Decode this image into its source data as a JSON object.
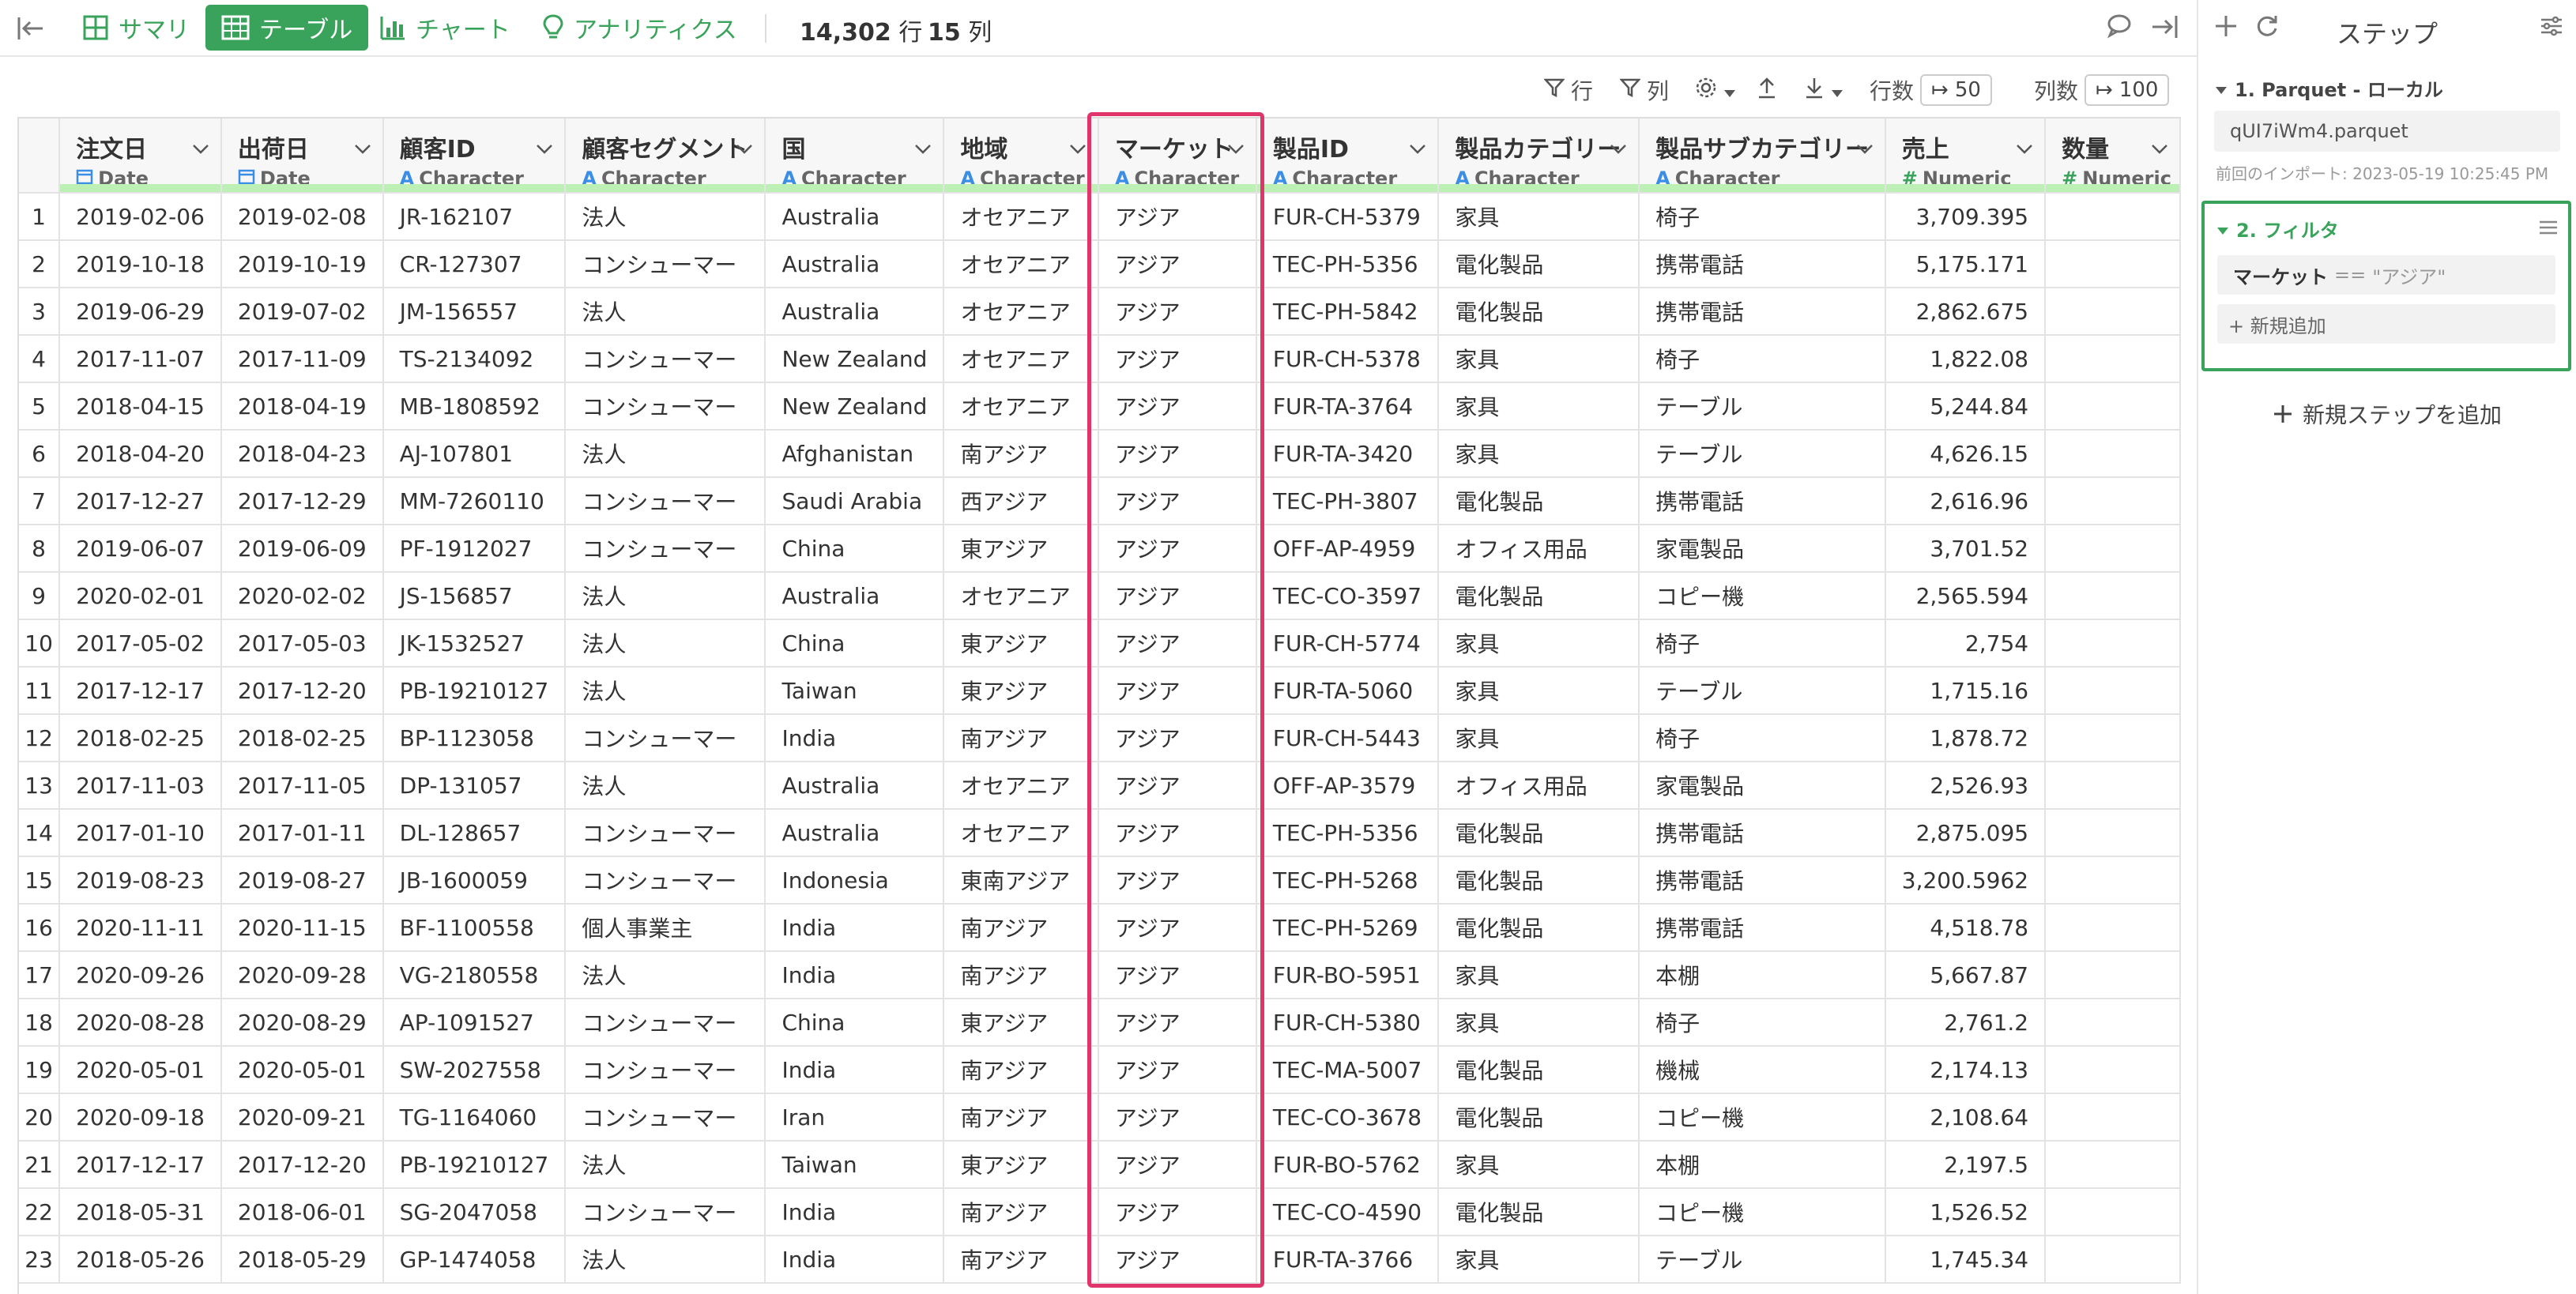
{
  "toolbar": {
    "tabs": [
      {
        "label": "サマリ",
        "icon": "summary-grid-icon"
      },
      {
        "label": "テーブル",
        "icon": "table-icon"
      },
      {
        "label": "チャート",
        "icon": "bar-chart-icon"
      },
      {
        "label": "アナリティクス",
        "icon": "lightbulb-icon"
      }
    ],
    "row_count": "14,302",
    "row_unit": "行",
    "col_count": "15",
    "col_unit": "列"
  },
  "toolbar2": {
    "row_filter_label": "行",
    "col_filter_label": "列",
    "rows_label": "行数",
    "rows_value": "50",
    "cols_label": "列数",
    "cols_value": "100"
  },
  "columns": [
    {
      "name": "注文日",
      "type": "Date",
      "kind": "date"
    },
    {
      "name": "出荷日",
      "type": "Date",
      "kind": "date"
    },
    {
      "name": "顧客ID",
      "type": "Character",
      "kind": "char"
    },
    {
      "name": "顧客セグメント",
      "type": "Character",
      "kind": "char"
    },
    {
      "name": "国",
      "type": "Character",
      "kind": "char"
    },
    {
      "name": "地域",
      "type": "Character",
      "kind": "char"
    },
    {
      "name": "マーケット",
      "type": "Character",
      "kind": "char"
    },
    {
      "name": "製品ID",
      "type": "Character",
      "kind": "char"
    },
    {
      "name": "製品カテゴリー",
      "type": "Character",
      "kind": "char"
    },
    {
      "name": "製品サブカテゴリー",
      "type": "Character",
      "kind": "char"
    },
    {
      "name": "売上",
      "type": "Numeric",
      "kind": "num"
    },
    {
      "name": "数量",
      "type": "Numeric",
      "kind": "num"
    }
  ],
  "rows": [
    [
      "1",
      "2019-02-06",
      "2019-02-08",
      "JR-162107",
      "法人",
      "Australia",
      "オセアニア",
      "アジア",
      "FUR-CH-5379",
      "家具",
      "椅子",
      "3,709.395"
    ],
    [
      "2",
      "2019-10-18",
      "2019-10-19",
      "CR-127307",
      "コンシューマー",
      "Australia",
      "オセアニア",
      "アジア",
      "TEC-PH-5356",
      "電化製品",
      "携帯電話",
      "5,175.171"
    ],
    [
      "3",
      "2019-06-29",
      "2019-07-02",
      "JM-156557",
      "法人",
      "Australia",
      "オセアニア",
      "アジア",
      "TEC-PH-5842",
      "電化製品",
      "携帯電話",
      "2,862.675"
    ],
    [
      "4",
      "2017-11-07",
      "2017-11-09",
      "TS-2134092",
      "コンシューマー",
      "New Zealand",
      "オセアニア",
      "アジア",
      "FUR-CH-5378",
      "家具",
      "椅子",
      "1,822.08"
    ],
    [
      "5",
      "2018-04-15",
      "2018-04-19",
      "MB-1808592",
      "コンシューマー",
      "New Zealand",
      "オセアニア",
      "アジア",
      "FUR-TA-3764",
      "家具",
      "テーブル",
      "5,244.84"
    ],
    [
      "6",
      "2018-04-20",
      "2018-04-23",
      "AJ-107801",
      "法人",
      "Afghanistan",
      "南アジア",
      "アジア",
      "FUR-TA-3420",
      "家具",
      "テーブル",
      "4,626.15"
    ],
    [
      "7",
      "2017-12-27",
      "2017-12-29",
      "MM-7260110",
      "コンシューマー",
      "Saudi Arabia",
      "西アジア",
      "アジア",
      "TEC-PH-3807",
      "電化製品",
      "携帯電話",
      "2,616.96"
    ],
    [
      "8",
      "2019-06-07",
      "2019-06-09",
      "PF-1912027",
      "コンシューマー",
      "China",
      "東アジア",
      "アジア",
      "OFF-AP-4959",
      "オフィス用品",
      "家電製品",
      "3,701.52"
    ],
    [
      "9",
      "2020-02-01",
      "2020-02-02",
      "JS-156857",
      "法人",
      "Australia",
      "オセアニア",
      "アジア",
      "TEC-CO-3597",
      "電化製品",
      "コピー機",
      "2,565.594"
    ],
    [
      "10",
      "2017-05-02",
      "2017-05-03",
      "JK-1532527",
      "法人",
      "China",
      "東アジア",
      "アジア",
      "FUR-CH-5774",
      "家具",
      "椅子",
      "2,754"
    ],
    [
      "11",
      "2017-12-17",
      "2017-12-20",
      "PB-19210127",
      "法人",
      "Taiwan",
      "東アジア",
      "アジア",
      "FUR-TA-5060",
      "家具",
      "テーブル",
      "1,715.16"
    ],
    [
      "12",
      "2018-02-25",
      "2018-02-25",
      "BP-1123058",
      "コンシューマー",
      "India",
      "南アジア",
      "アジア",
      "FUR-CH-5443",
      "家具",
      "椅子",
      "1,878.72"
    ],
    [
      "13",
      "2017-11-03",
      "2017-11-05",
      "DP-131057",
      "法人",
      "Australia",
      "オセアニア",
      "アジア",
      "OFF-AP-3579",
      "オフィス用品",
      "家電製品",
      "2,526.93"
    ],
    [
      "14",
      "2017-01-10",
      "2017-01-11",
      "DL-128657",
      "コンシューマー",
      "Australia",
      "オセアニア",
      "アジア",
      "TEC-PH-5356",
      "電化製品",
      "携帯電話",
      "2,875.095"
    ],
    [
      "15",
      "2019-08-23",
      "2019-08-27",
      "JB-1600059",
      "コンシューマー",
      "Indonesia",
      "東南アジア",
      "アジア",
      "TEC-PH-5268",
      "電化製品",
      "携帯電話",
      "3,200.5962"
    ],
    [
      "16",
      "2020-11-11",
      "2020-11-15",
      "BF-1100558",
      "個人事業主",
      "India",
      "南アジア",
      "アジア",
      "TEC-PH-5269",
      "電化製品",
      "携帯電話",
      "4,518.78"
    ],
    [
      "17",
      "2020-09-26",
      "2020-09-28",
      "VG-2180558",
      "法人",
      "India",
      "南アジア",
      "アジア",
      "FUR-BO-5951",
      "家具",
      "本棚",
      "5,667.87"
    ],
    [
      "18",
      "2020-08-28",
      "2020-08-29",
      "AP-1091527",
      "コンシューマー",
      "China",
      "東アジア",
      "アジア",
      "FUR-CH-5380",
      "家具",
      "椅子",
      "2,761.2"
    ],
    [
      "19",
      "2020-05-01",
      "2020-05-01",
      "SW-2027558",
      "コンシューマー",
      "India",
      "南アジア",
      "アジア",
      "TEC-MA-5007",
      "電化製品",
      "機械",
      "2,174.13"
    ],
    [
      "20",
      "2020-09-18",
      "2020-09-21",
      "TG-1164060",
      "コンシューマー",
      "Iran",
      "南アジア",
      "アジア",
      "TEC-CO-3678",
      "電化製品",
      "コピー機",
      "2,108.64"
    ],
    [
      "21",
      "2017-12-17",
      "2017-12-20",
      "PB-19210127",
      "法人",
      "Taiwan",
      "東アジア",
      "アジア",
      "FUR-BO-5762",
      "家具",
      "本棚",
      "2,197.5"
    ],
    [
      "22",
      "2018-05-31",
      "2018-06-01",
      "SG-2047058",
      "コンシューマー",
      "India",
      "南アジア",
      "アジア",
      "TEC-CO-4590",
      "電化製品",
      "コピー機",
      "1,526.52"
    ],
    [
      "23",
      "2018-05-26",
      "2018-05-29",
      "GP-1474058",
      "法人",
      "India",
      "南アジア",
      "アジア",
      "FUR-TA-3766",
      "家具",
      "テーブル",
      "1,745.34"
    ]
  ],
  "panel": {
    "title": "ステップ",
    "step1_title": "1. Parquet - ローカル",
    "step1_file": "qUI7iWm4.parquet",
    "step1_note": "前回のインポート: 2023-05-19 10:25:45 PM",
    "step2_title": "2. フィルタ",
    "filter_column": "マーケット",
    "filter_op": "==",
    "filter_value": "\"アジア\"",
    "add_new": "+ 新規追加",
    "add_step": "新規ステップを追加"
  },
  "colors": {
    "accent": "#3aa35b",
    "highlight": "#e0356a",
    "type_char": "#3a8ee6",
    "header_bar": "#bdf0b5"
  }
}
